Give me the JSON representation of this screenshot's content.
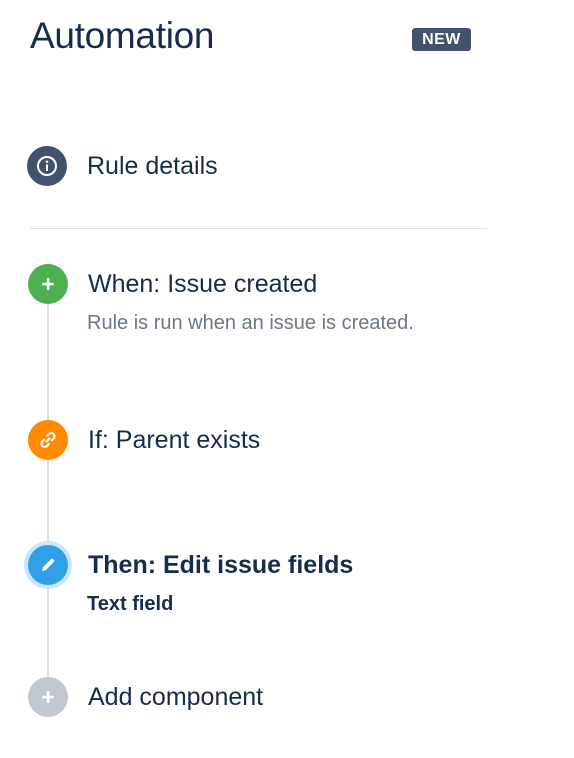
{
  "header": {
    "title": "Automation",
    "badge": "NEW"
  },
  "rule_details": {
    "label": "Rule details",
    "icon": "info-icon"
  },
  "steps": [
    {
      "label": "When: Issue created",
      "description": "Rule is run when an issue is created.",
      "icon": "plus-icon",
      "color": "#4caf50"
    },
    {
      "label": "If: Parent exists",
      "description": "",
      "icon": "link-icon",
      "color": "#ff8b00"
    },
    {
      "label": "Then: Edit issue fields",
      "description": "Text field",
      "icon": "pencil-icon",
      "color": "#2f9fe6",
      "selected": true
    }
  ],
  "add_component": {
    "label": "Add component",
    "icon": "plus-icon",
    "color": "#c1c7d0"
  },
  "colors": {
    "heading": "#172b4d",
    "badge": "#42526e",
    "muted": "#6b778c"
  }
}
